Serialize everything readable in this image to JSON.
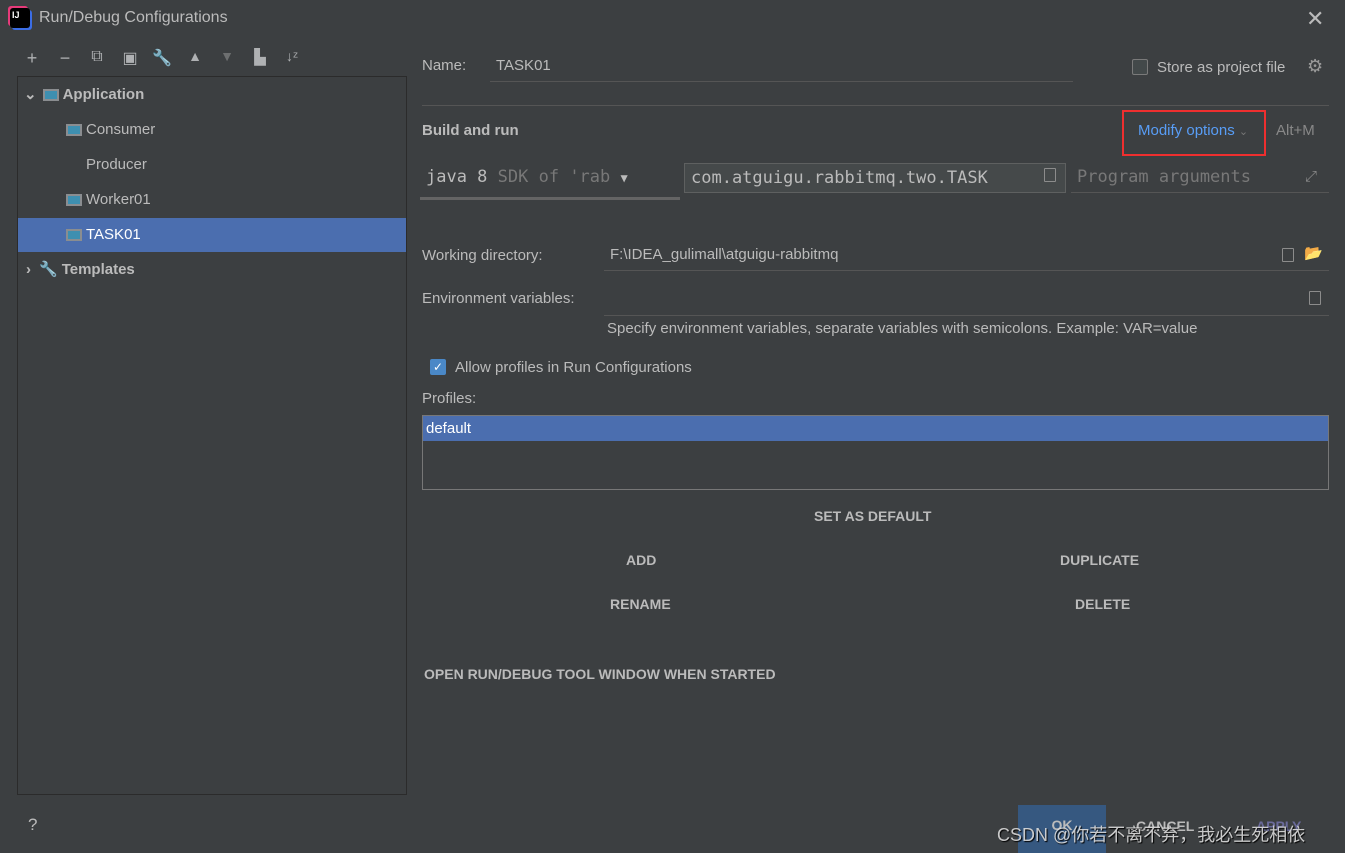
{
  "window": {
    "title": "Run/Debug Configurations",
    "close_icon": "close-icon"
  },
  "toolbar": [
    "add-icon",
    "remove-icon",
    "copy-icon",
    "save-icon",
    "wrench-icon",
    "move-up-icon",
    "move-down-icon",
    "new-folder-icon",
    "sort-icon"
  ],
  "tree": {
    "items": [
      {
        "label": "Application",
        "level": 0,
        "expanded": true,
        "bold": true
      },
      {
        "label": "Consumer",
        "level": 1
      },
      {
        "label": "Producer",
        "level": 1
      },
      {
        "label": "Worker01",
        "level": 1
      },
      {
        "label": "TASK01",
        "level": 1,
        "selected": true
      },
      {
        "label": "Templates",
        "level": 0,
        "expanded": false,
        "bold": true
      }
    ]
  },
  "name": {
    "label": "Name:",
    "value": "TASK01"
  },
  "store": {
    "label": "Store as project file",
    "checked": false
  },
  "build": {
    "title": "Build and run",
    "modify": "Modify options",
    "shortcut": "Alt+M",
    "jre_main": "java 8",
    "jre_hint": "SDK of 'rab",
    "main_class": "com.atguigu.rabbitmq.two.TASK",
    "args_placeholder": "Program arguments"
  },
  "workdir": {
    "label": "Working directory:",
    "value": "F:\\IDEA_gulimall\\atguigu-rabbitmq"
  },
  "env": {
    "label": "Environment variables:",
    "value": "",
    "hint": "Specify environment variables, separate variables with semicolons. Example: VAR=value"
  },
  "profiles": {
    "allow_label": "Allow profiles in Run Configurations",
    "allow_checked": true,
    "label": "Profiles:",
    "items": [
      "default"
    ],
    "selected": "default"
  },
  "buttons": {
    "set_default": "SET AS DEFAULT",
    "add": "ADD",
    "duplicate": "DUPLICATE",
    "rename": "RENAME",
    "delete": "DELETE",
    "open_tool": "OPEN RUN/DEBUG TOOL WINDOW WHEN STARTED",
    "ok": "OK",
    "cancel": "CANCEL",
    "apply": "APPLY",
    "help": "?"
  },
  "watermark": "CSDN @你若不离不弃，我必生死相依",
  "colors": {
    "background": "#3c3f41",
    "selection": "#4b6eaf",
    "link": "#589df6",
    "highlight_box": "#ef2f2f",
    "ok_button": "#365880"
  }
}
